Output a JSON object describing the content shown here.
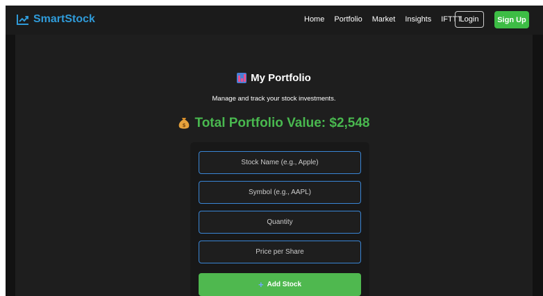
{
  "navbar": {
    "brand": "SmartStock",
    "brand_color": "#2f9bd9",
    "links": [
      "Home",
      "Portfolio",
      "Market",
      "Insights",
      "IFTTT"
    ],
    "login_label": "Login",
    "signup_label": "Sign Up",
    "signup_color": "#3dbd45"
  },
  "header": {
    "title": "My Portfolio",
    "title_icon": "bar-chart-icon",
    "subtitle": "Manage and track your stock investments.",
    "total_label": "Total Portfolio Value: $2,548",
    "total_icon": "money-bag-icon",
    "total_color": "#49b84f"
  },
  "form": {
    "stock_name_placeholder": "Stock Name (e.g., Apple)",
    "symbol_placeholder": "Symbol (e.g., AAPL)",
    "quantity_placeholder": "Quantity",
    "price_placeholder": "Price per Share",
    "add_label": "Add Stock",
    "add_icon": "plus-icon",
    "input_border_color": "#3a86d6",
    "button_color": "#4fb84f"
  }
}
